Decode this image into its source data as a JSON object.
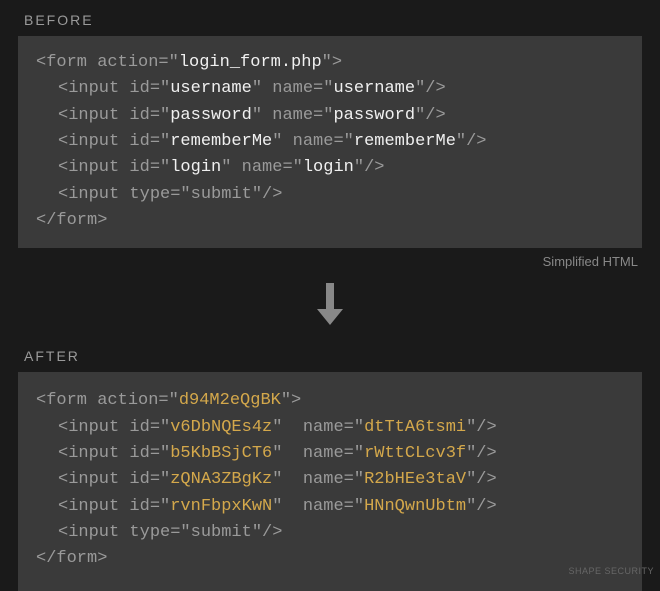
{
  "before": {
    "label": "BEFORE",
    "form_action": "login_form.php",
    "inputs": [
      {
        "id": "username",
        "name": "username"
      },
      {
        "id": "password",
        "name": "password"
      },
      {
        "id": "rememberMe",
        "name": "rememberMe"
      },
      {
        "id": "login",
        "name": "login"
      }
    ],
    "submit_type": "submit",
    "caption": "Simplified HTML"
  },
  "after": {
    "label": "AFTER",
    "form_action": "d94M2eQgBK",
    "inputs": [
      {
        "id": "v6DbNQEs4z",
        "name": "dtTtA6tsmi"
      },
      {
        "id": "b5KbBSjCT6",
        "name": "rWttCLcv3f"
      },
      {
        "id": "zQNA3ZBgKz",
        "name": "R2bHEe3taV"
      },
      {
        "id": "rvnFbpxKwN",
        "name": "HNnQwnUbtm"
      }
    ],
    "submit_type": "submit"
  },
  "credit": "SHAPE SECURITY"
}
